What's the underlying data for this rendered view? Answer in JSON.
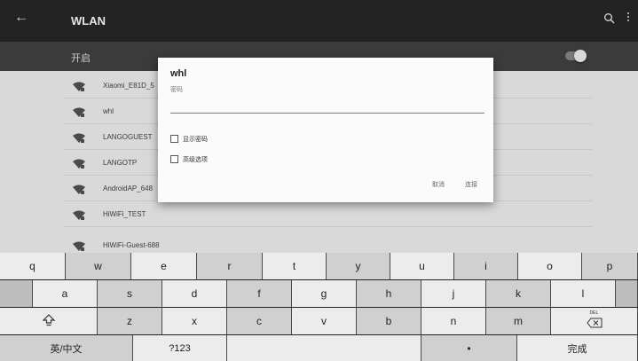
{
  "topbar": {
    "title": "WLAN"
  },
  "wifi_switch": {
    "label": "开启",
    "state": "on"
  },
  "networks": [
    {
      "name": "Xiaomi_E81D_5"
    },
    {
      "name": "whl"
    },
    {
      "name": "LANGOGUEST"
    },
    {
      "name": "LANGOTP"
    },
    {
      "name": "AndroidAP_648"
    },
    {
      "name": "HiWiFi_TEST"
    },
    {
      "name": "HiWiFi-Guest-688"
    }
  ],
  "dialog": {
    "title": "whl",
    "password_label": "密码",
    "password_value": "",
    "show_password_label": "显示密码",
    "advanced_label": "高级选项",
    "cancel_label": "取消",
    "connect_label": "连接"
  },
  "keyboard": {
    "row1": [
      "q",
      "w",
      "e",
      "r",
      "t",
      "y",
      "u",
      "i",
      "o",
      "p"
    ],
    "row2": [
      "a",
      "s",
      "d",
      "f",
      "g",
      "h",
      "j",
      "k",
      "l"
    ],
    "row3": [
      "z",
      "x",
      "c",
      "v",
      "b",
      "n",
      "m"
    ],
    "lang_label": "英/中文",
    "symbols_label": "?123",
    "done_label": "完成",
    "delete_text": "DEL"
  },
  "colors": {
    "topbar": "#232323",
    "list_bg": "#d9d9d9",
    "dialog_bg": "#fbfbfb"
  }
}
